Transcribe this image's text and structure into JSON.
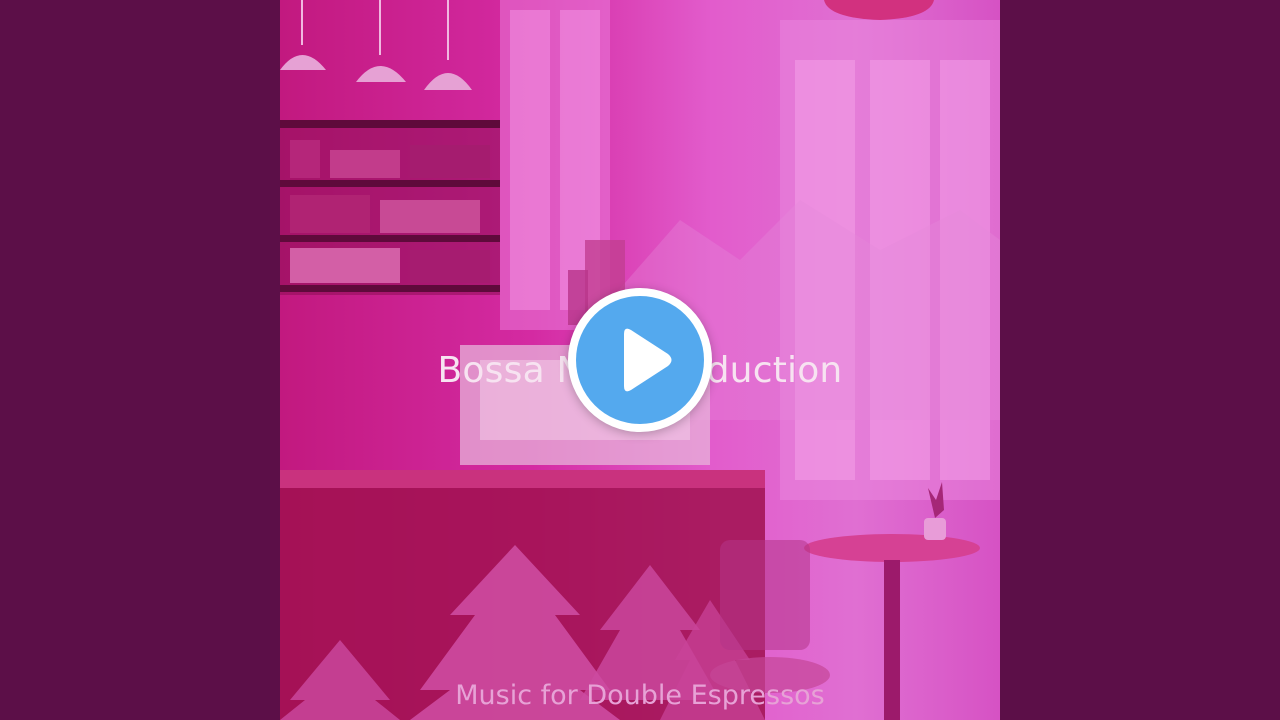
{
  "player": {
    "title": "Bossa Nova Seduction",
    "subtitle": "Music for Double Espressos",
    "play_icon": "play-icon",
    "accent_color": "#54a9ee",
    "background_color": "#5c0f48",
    "art_tint": "#d42aa2"
  }
}
